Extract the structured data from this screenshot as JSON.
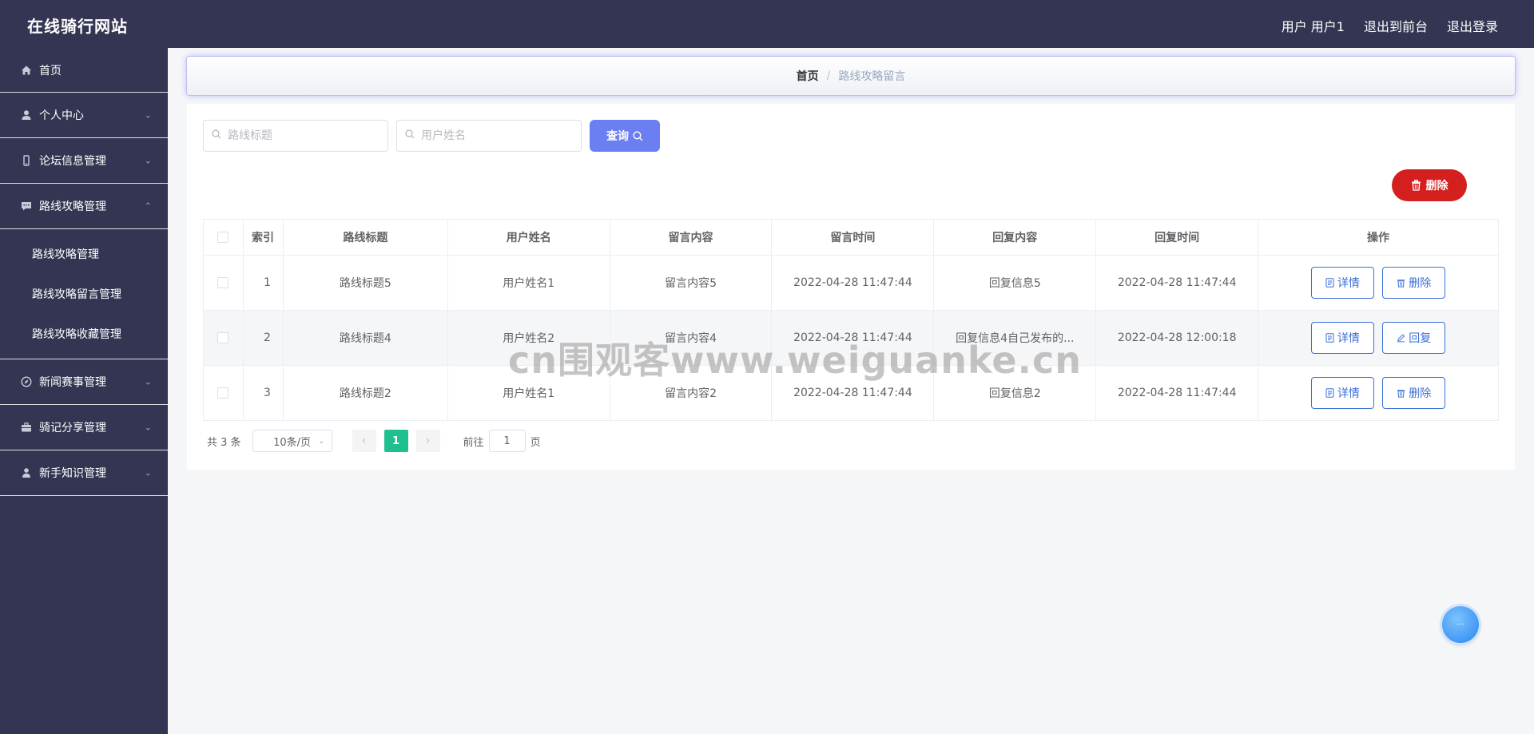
{
  "header": {
    "title": "在线骑行网站",
    "user_label": "用户 用户1",
    "front_link": "退出到前台",
    "logout_link": "退出登录"
  },
  "sidebar": {
    "items": [
      {
        "label": "首页",
        "icon": "home-icon"
      },
      {
        "label": "个人中心",
        "icon": "user-icon"
      },
      {
        "label": "论坛信息管理",
        "icon": "phone-icon"
      },
      {
        "label": "路线攻略管理",
        "icon": "chat-icon"
      },
      {
        "label": "新闻赛事管理",
        "icon": "compass-icon"
      },
      {
        "label": "骑记分享管理",
        "icon": "briefcase-icon"
      },
      {
        "label": "新手知识管理",
        "icon": "person-icon"
      }
    ],
    "submenu": [
      "路线攻略管理",
      "路线攻略留言管理",
      "路线攻略收藏管理"
    ]
  },
  "breadcrumb": {
    "home": "首页",
    "separator": "/",
    "current": "路线攻略留言"
  },
  "search": {
    "title_placeholder": "路线标题",
    "username_placeholder": "用户姓名",
    "query_button": "查询",
    "delete_button": "删除"
  },
  "table": {
    "headers": [
      "索引",
      "路线标题",
      "用户姓名",
      "留言内容",
      "留言时间",
      "回复内容",
      "回复时间",
      "操作"
    ],
    "rows": [
      {
        "index": "1",
        "route_title": "路线标题5",
        "username": "用户姓名1",
        "message": "留言内容5",
        "message_time": "2022-04-28 11:47:44",
        "reply": "回复信息5",
        "reply_time": "2022-04-28 11:47:44",
        "btn1": "详情",
        "btn2": "删除"
      },
      {
        "index": "2",
        "route_title": "路线标题4",
        "username": "用户姓名2",
        "message": "留言内容4",
        "message_time": "2022-04-28 11:47:44",
        "reply": "回复信息4自己发布的...",
        "reply_time": "2022-04-28 12:00:18",
        "btn1": "详情",
        "btn2": "回复"
      },
      {
        "index": "3",
        "route_title": "路线标题2",
        "username": "用户姓名1",
        "message": "留言内容2",
        "message_time": "2022-04-28 11:47:44",
        "reply": "回复信息2",
        "reply_time": "2022-04-28 11:47:44",
        "btn1": "详情",
        "btn2": "删除"
      }
    ]
  },
  "pagination": {
    "total": "共 3 条",
    "page_size": "10条/页",
    "current_page": "1",
    "goto_label": "前往",
    "goto_value": "1",
    "page_unit": "页"
  },
  "watermark": "cn围观客www.weiguanke.cn",
  "colors": {
    "sidebar": "#333552",
    "primary": "#6b7ef2",
    "danger": "#d41f1f",
    "active_page": "#1fbf8f",
    "outline": "#3a6fd8"
  }
}
